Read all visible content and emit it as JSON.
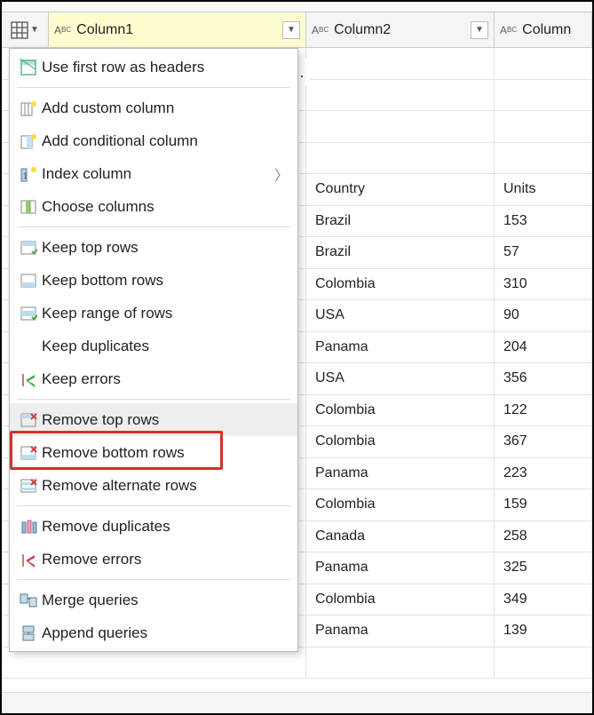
{
  "header": {
    "col1": "Column1",
    "col2": "Column2",
    "col3": "Column"
  },
  "rows": [
    {
      "c1": "",
      "c2": ""
    },
    {
      "c1": "",
      "c2": ""
    },
    {
      "c1": "",
      "c2": ""
    },
    {
      "c1": "",
      "c2": ""
    },
    {
      "c1": "Country",
      "c2": "Units"
    },
    {
      "c1": "Brazil",
      "c2": "153"
    },
    {
      "c1": "Brazil",
      "c2": "57"
    },
    {
      "c1": "Colombia",
      "c2": "310"
    },
    {
      "c1": "USA",
      "c2": "90"
    },
    {
      "c1": "Panama",
      "c2": "204"
    },
    {
      "c1": "USA",
      "c2": "356"
    },
    {
      "c1": "Colombia",
      "c2": "122"
    },
    {
      "c1": "Colombia",
      "c2": "367"
    },
    {
      "c1": "Panama",
      "c2": "223"
    },
    {
      "c1": "Colombia",
      "c2": "159"
    },
    {
      "c1": "Canada",
      "c2": "258"
    },
    {
      "c1": "Panama",
      "c2": "325"
    },
    {
      "c1": "Colombia",
      "c2": "349"
    },
    {
      "c1": "Panama",
      "c2": "139"
    },
    {
      "c1": "",
      "c2": ""
    }
  ],
  "menu": {
    "use_first_row": "Use first row as headers",
    "add_custom": "Add custom column",
    "add_conditional": "Add conditional column",
    "index_column": "Index column",
    "choose_columns": "Choose columns",
    "keep_top": "Keep top rows",
    "keep_bottom": "Keep bottom rows",
    "keep_range": "Keep range of rows",
    "keep_duplicates": "Keep duplicates",
    "keep_errors": "Keep errors",
    "remove_top": "Remove top rows",
    "remove_bottom": "Remove bottom rows",
    "remove_alternate": "Remove alternate rows",
    "remove_duplicates": "Remove duplicates",
    "remove_errors": "Remove errors",
    "merge_queries": "Merge queries",
    "append_queries": "Append queries",
    "ellipsis": "..."
  }
}
